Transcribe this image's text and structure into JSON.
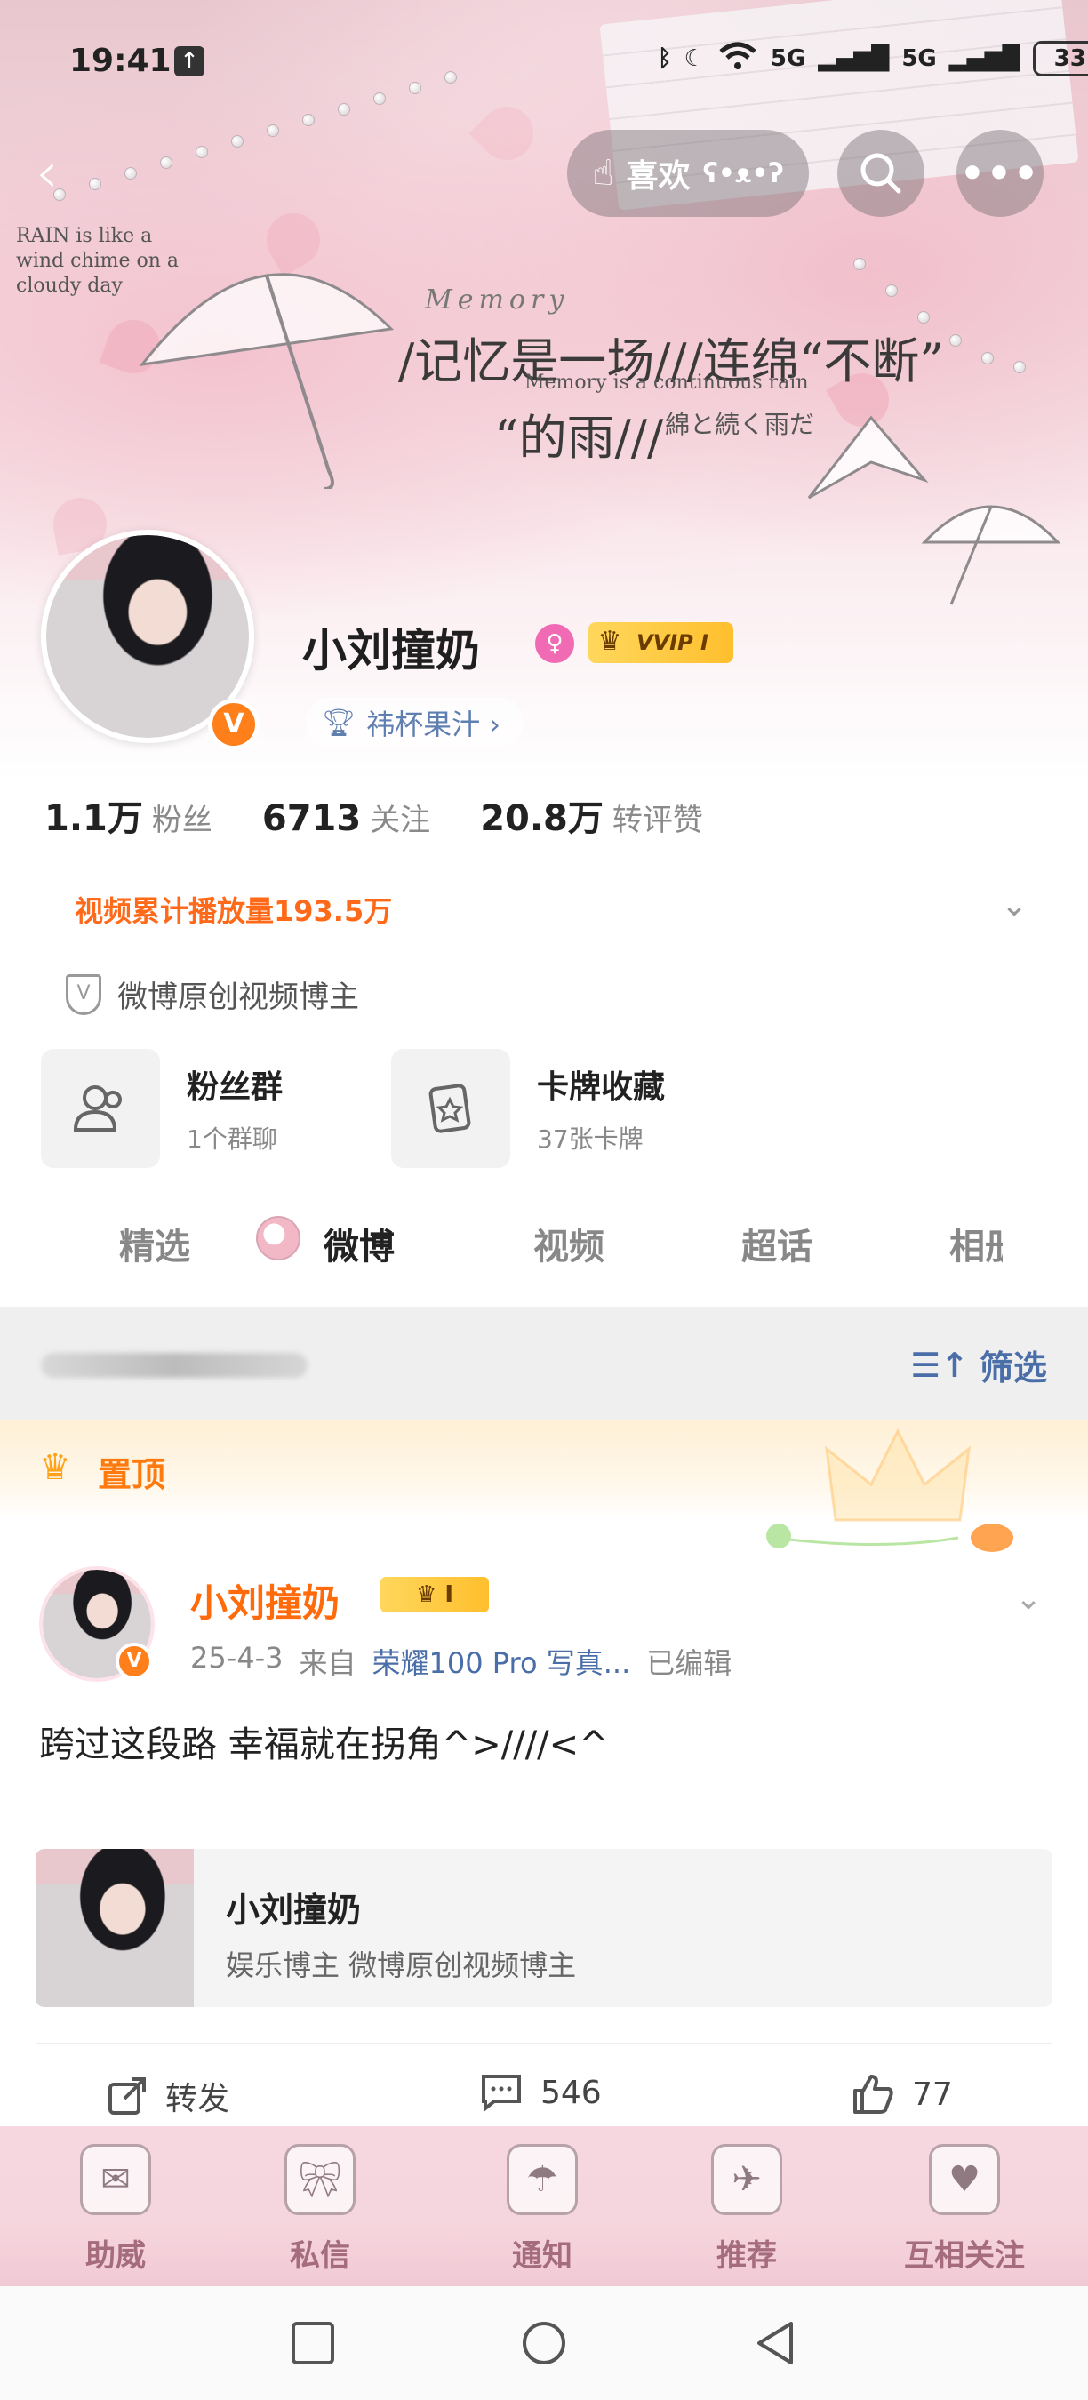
{
  "status_bar": {
    "time": "19:41",
    "upload_icon": "upload-icon",
    "signal_1": "5G",
    "signal_2": "5G",
    "battery": "33"
  },
  "header": {
    "banner_title_1": "/记忆是一场///连绵“不断”",
    "banner_title_2": "“的雨///",
    "banner_en": "Memory is a continuous rain",
    "banner_jp": "綿と続く雨だ",
    "banner_small": "RAIN is like a wind chime on a cloudy day",
    "banner_memory": "Memory",
    "like_label": "喜欢",
    "search_icon": "search-icon",
    "more_label": "•••"
  },
  "profile": {
    "name": "小刘撞奶",
    "gender": "♀",
    "vip_label": "VVIP I",
    "fan_tag": "祎杯果汁 ›",
    "verify_mark": "V",
    "stats": [
      {
        "num": "1.1万",
        "label": "粉丝"
      },
      {
        "num": "6713",
        "label": "关注"
      },
      {
        "num": "20.8万",
        "label": "转评赞"
      }
    ],
    "play_count": "视频累计播放量193.5万",
    "certification": "微博原创视频博主"
  },
  "cards": [
    {
      "title": "粉丝群",
      "sub": "1个群聊"
    },
    {
      "title": "卡牌收藏",
      "sub": "37张卡牌"
    }
  ],
  "tabs": [
    "精选",
    "微博",
    "视频",
    "超话",
    "相册"
  ],
  "active_tab": "微博",
  "filter": {
    "label": "筛选"
  },
  "pinned": {
    "label": "置顶"
  },
  "post": {
    "author": "小刘撞奶",
    "vip": "I",
    "date": "25-4-3",
    "from": "来自",
    "device": "荣耀100 Pro 写真...",
    "edited": "已编辑",
    "text": "跨过这段路 幸福就在拐角^>////<^",
    "share_title": "小刘撞奶",
    "share_sub": "娱乐博主 微博原创视频博主",
    "actions": [
      {
        "icon": "share-icon",
        "label": "转发"
      },
      {
        "icon": "comment-icon",
        "label": "546"
      },
      {
        "icon": "like-icon",
        "label": "77"
      }
    ]
  },
  "bottom_nav": [
    {
      "label": "助威",
      "icon": "cheer-icon"
    },
    {
      "label": "私信",
      "icon": "message-icon"
    },
    {
      "label": "通知",
      "icon": "notification-icon"
    },
    {
      "label": "推荐",
      "icon": "recommend-icon"
    },
    {
      "label": "互相关注",
      "icon": "mutual-follow-icon"
    }
  ],
  "colors": {
    "accent_orange": "#ff6a1a",
    "link_blue": "#4a6ea8",
    "banner_pink": "#f4d7de"
  }
}
